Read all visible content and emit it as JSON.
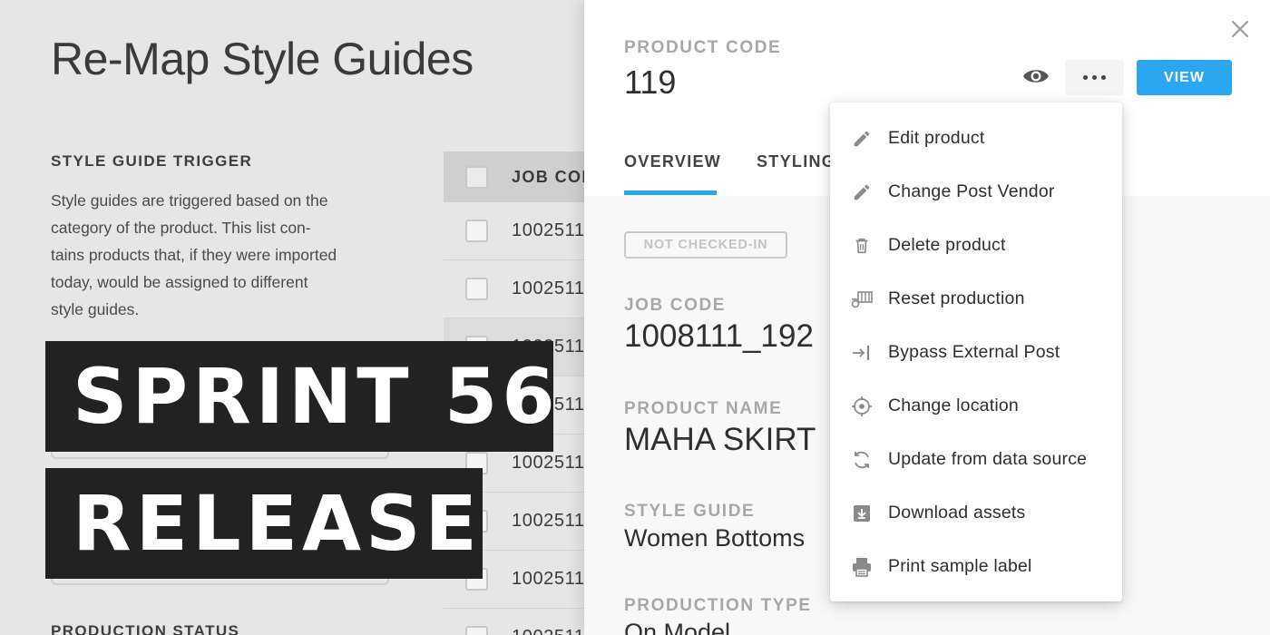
{
  "background": {
    "title": "Re-Map Style Guides",
    "trigger_heading": "STYLE GUIDE TRIGGER",
    "trigger_lines": [
      "Style guides are triggered based on the",
      "category of the product. This list con-",
      "tains products that, if they were imported",
      "today, would be assigned to different",
      "style guides."
    ],
    "status_heading": "PRODUCTION STATUS",
    "table_header": "JOB CODE",
    "rows": [
      "1002511",
      "1002511",
      "1002511",
      "1002511",
      "1002511",
      "1002511",
      "1002511",
      "1002511"
    ]
  },
  "banner": {
    "line1": "SPRINT 56",
    "line2": "RELEASE"
  },
  "drawer": {
    "product_code_label": "PRODUCT CODE",
    "product_code": "119",
    "view_label": "VIEW",
    "tabs": [
      {
        "label": "OVERVIEW",
        "active": true
      },
      {
        "label": "STYLING",
        "active": false
      }
    ],
    "status_badge": "NOT CHECKED-IN",
    "fields": {
      "job_code_label": "JOB CODE",
      "job_code": "1008111_192",
      "product_name_label": "PRODUCT NAME",
      "product_name": "MAHA SKIRT",
      "style_guide_label": "STYLE GUIDE",
      "style_guide": "Women Bottoms",
      "production_type_label": "PRODUCTION TYPE",
      "production_type": "On Model"
    }
  },
  "menu": {
    "items": [
      {
        "label": "Edit product",
        "icon": "pencil-icon"
      },
      {
        "label": "Change Post Vendor",
        "icon": "pencil-icon"
      },
      {
        "label": "Delete product",
        "icon": "trash-icon"
      },
      {
        "label": "Reset production",
        "icon": "reset-production-icon"
      },
      {
        "label": "Bypass External Post",
        "icon": "bypass-icon"
      },
      {
        "label": "Change location",
        "icon": "location-icon"
      },
      {
        "label": "Update from data source",
        "icon": "refresh-icon"
      },
      {
        "label": "Download assets",
        "icon": "download-icon"
      },
      {
        "label": "Print sample label",
        "icon": "printer-icon"
      }
    ]
  },
  "colors": {
    "accent": "#2ba7f2",
    "banner_bg": "#222222",
    "icon_gray": "#8a8a8a"
  }
}
